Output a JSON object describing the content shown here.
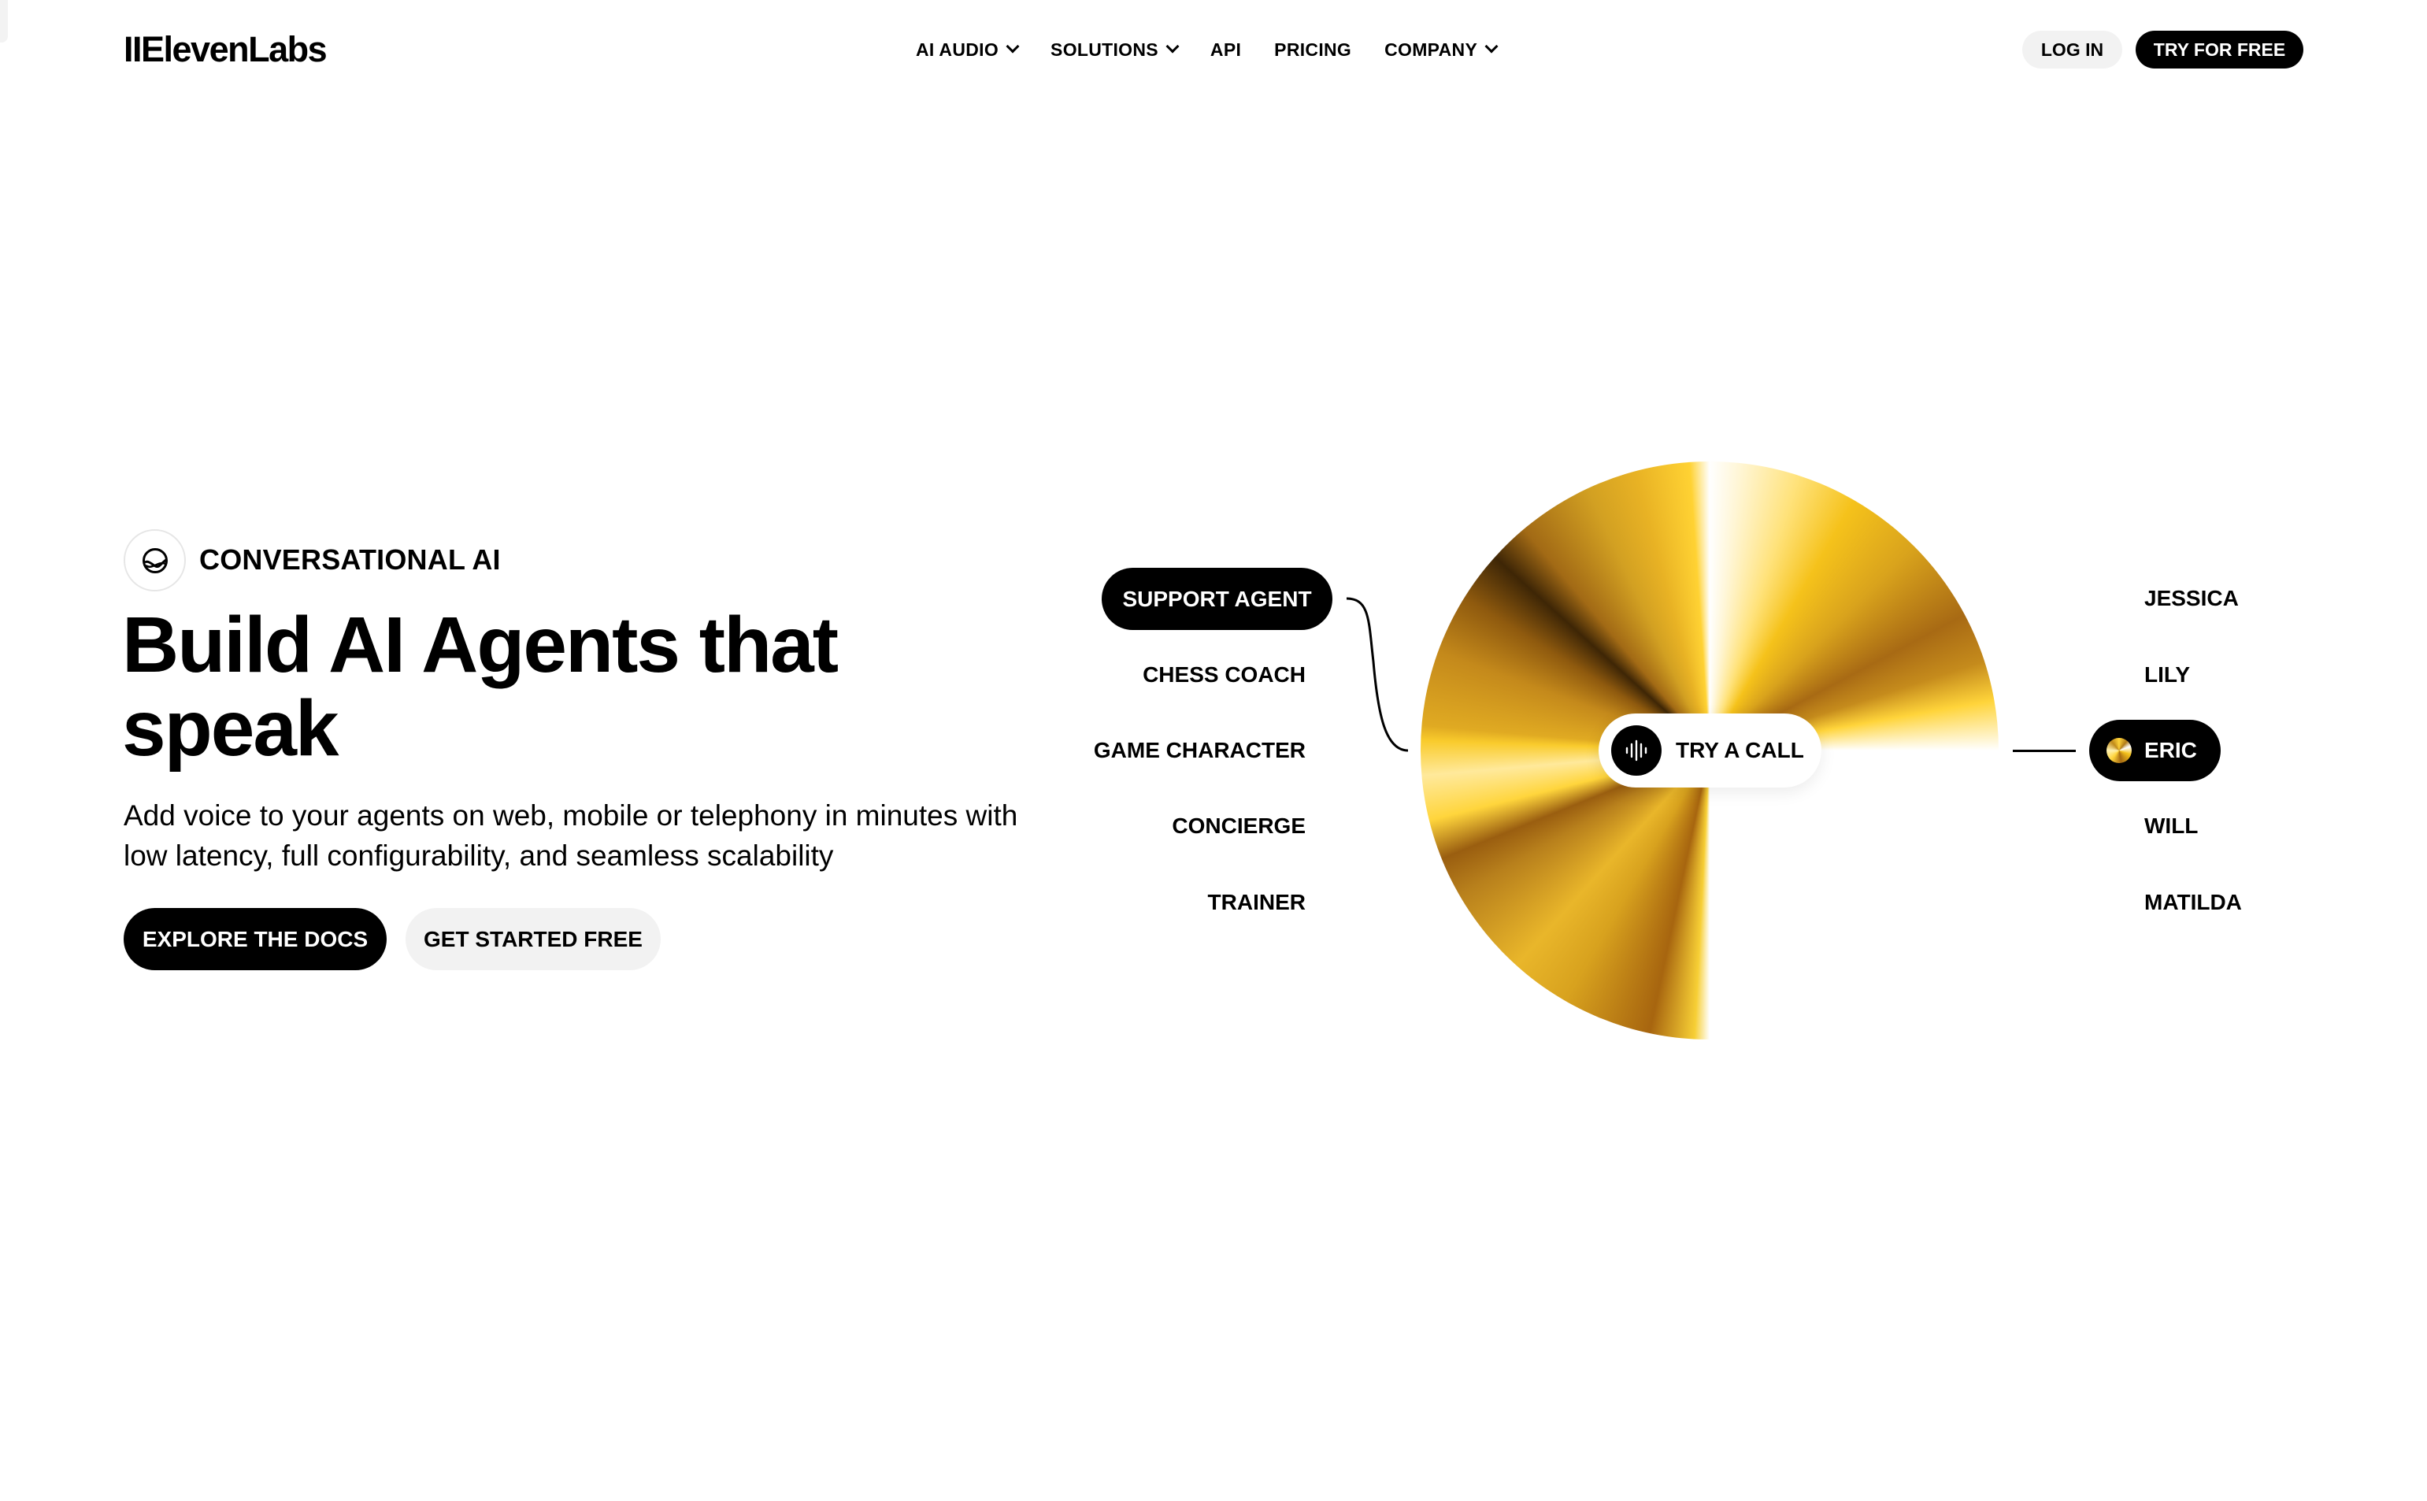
{
  "header": {
    "logo": "IIElevenLabs",
    "nav": [
      {
        "label": "AI AUDIO",
        "has_dropdown": true
      },
      {
        "label": "SOLUTIONS",
        "has_dropdown": true
      },
      {
        "label": "API",
        "has_dropdown": false
      },
      {
        "label": "PRICING",
        "has_dropdown": false
      },
      {
        "label": "COMPANY",
        "has_dropdown": true
      }
    ],
    "login_label": "LOG IN",
    "try_free_label": "TRY FOR FREE"
  },
  "hero": {
    "badge_icon": "conversational-ai-icon",
    "badge_label": "CONVERSATIONAL AI",
    "headline": "Build AI Agents that speak",
    "subtext": "Add voice to your agents on web, mobile or telephony in minutes with low latency, full configurability, and seamless scalability",
    "primary_button": "EXPLORE THE DOCS",
    "secondary_button": "GET STARTED FREE"
  },
  "demo": {
    "agents": [
      {
        "label": "SUPPORT AGENT",
        "selected": true
      },
      {
        "label": "CHESS COACH",
        "selected": false
      },
      {
        "label": "GAME CHARACTER",
        "selected": false
      },
      {
        "label": "CONCIERGE",
        "selected": false
      },
      {
        "label": "TRAINER",
        "selected": false
      }
    ],
    "call_button": {
      "icon": "audio-waveform-icon",
      "label": "TRY A CALL"
    },
    "voices": [
      {
        "label": "JESSICA",
        "selected": false
      },
      {
        "label": "LILY",
        "selected": false
      },
      {
        "label": "ERIC",
        "selected": true
      },
      {
        "label": "WILL",
        "selected": false
      },
      {
        "label": "MATILDA",
        "selected": false
      }
    ],
    "colors": {
      "gold": "#f5c21b",
      "gold_dark": "#a86a14",
      "black": "#000000"
    }
  }
}
